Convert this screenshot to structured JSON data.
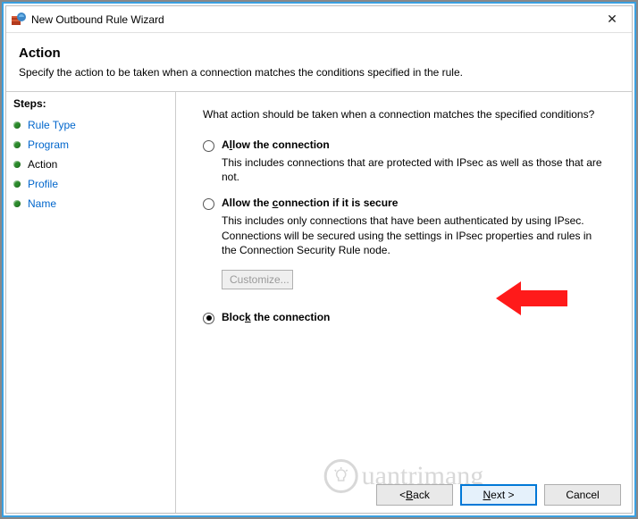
{
  "window": {
    "title": "New Outbound Rule Wizard",
    "close_label": "✕"
  },
  "header": {
    "heading": "Action",
    "subtext": "Specify the action to be taken when a connection matches the conditions specified in the rule."
  },
  "steps": {
    "title": "Steps:",
    "items": [
      {
        "label": "Rule Type",
        "current": false
      },
      {
        "label": "Program",
        "current": false
      },
      {
        "label": "Action",
        "current": true
      },
      {
        "label": "Profile",
        "current": false
      },
      {
        "label": "Name",
        "current": false
      }
    ]
  },
  "content": {
    "prompt": "What action should be taken when a connection matches the specified conditions?",
    "opt1": {
      "pre": "A",
      "ul": "l",
      "post": "low the connection",
      "desc": "This includes connections that are protected with IPsec as well as those that are not."
    },
    "opt2": {
      "label_plain": "Allow the ",
      "ul": "c",
      "post": "onnection if it is secure",
      "desc": "This includes only connections that have been authenticated by using IPsec.  Connections will be secured using the settings in IPsec properties and rules in the Connection Security Rule node.",
      "customize": "Customize..."
    },
    "opt3": {
      "pre": "Bloc",
      "ul": "k",
      "post": " the connection"
    },
    "selected": "opt3"
  },
  "buttons": {
    "back_pre": "< ",
    "back_ul": "B",
    "back_post": "ack",
    "next_ul": "N",
    "next_post": "ext >",
    "cancel": "Cancel"
  },
  "watermark": "uantrimang"
}
